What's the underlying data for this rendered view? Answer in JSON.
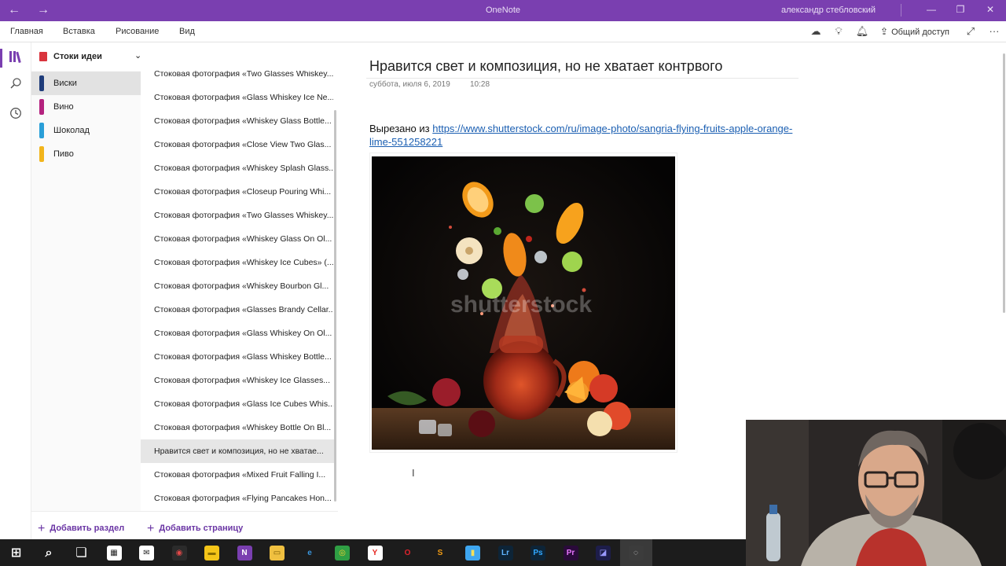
{
  "window": {
    "title": "OneNote",
    "user": "александр стебловский",
    "back_icon": "←",
    "forward_icon": "→",
    "minimize": "—",
    "restore": "❐",
    "close": "✕"
  },
  "menu": {
    "items": [
      "Главная",
      "Вставка",
      "Рисование",
      "Вид"
    ],
    "share_label": "Общий доступ",
    "more": "···"
  },
  "notebook": {
    "name": "Стоки идеи",
    "chevron": "⌄"
  },
  "sections": [
    {
      "label": "Виски",
      "color": "#1f3c7a"
    },
    {
      "label": "Вино",
      "color": "#b4237f"
    },
    {
      "label": "Шоколад",
      "color": "#2a9fd8"
    },
    {
      "label": "Пиво",
      "color": "#f2b51c"
    }
  ],
  "pages": [
    "Стоковая фотография «Two Glasses Whiskey...",
    "Стоковая фотография «Glass Whiskey Ice Ne...",
    "Стоковая фотография «Whiskey Glass Bottle...",
    "Стоковая фотография «Close View Two Glas...",
    "Стоковая фотография «Whiskey Splash Glass...",
    "Стоковая фотография «Closeup Pouring Whi...",
    "Стоковая фотография «Two Glasses Whiskey...",
    "Стоковая фотография «Whiskey Glass On Ol...",
    "Стоковая фотография «Whiskey Ice Cubes» (...",
    "Стоковая фотография «Whiskey Bourbon Gl...",
    "Стоковая фотография «Glasses Brandy Cellar...",
    "Стоковая фотография «Glass Whiskey On Ol...",
    "Стоковая фотография «Glass Whiskey Bottle...",
    "Стоковая фотография «Whiskey Ice Glasses...",
    "Стоковая фотография «Glass Ice Cubes Whis...",
    "Стоковая фотография «Whiskey Bottle On Bl...",
    "Нравится свет и композиция, но не хватае...",
    "Стоковая фотография «Mixed Fruit Falling I...",
    "Стоковая фотография «Flying Pancakes Hon..."
  ],
  "bottom": {
    "add_section": "Добавить раздел",
    "add_page": "Добавить страницу"
  },
  "note": {
    "title": "Нравится свет и композиция, но не хватает контрвого",
    "date": "суббота, июля 6, 2019",
    "time": "10:28",
    "clip_prefix": "Вырезано из",
    "clip_url": "https://www.shutterstock.com/ru/image-photo/sangria-flying-fruits-apple-orange-lime-551258221",
    "watermark": "shutterstock"
  },
  "taskbar": [
    {
      "name": "start-icon",
      "glyph": "⊞",
      "bg": "transparent",
      "fg": "#ffffff"
    },
    {
      "name": "search-icon",
      "glyph": "⌕",
      "bg": "transparent",
      "fg": "#ffffff"
    },
    {
      "name": "task-view-icon",
      "glyph": "❏",
      "bg": "transparent",
      "fg": "#ffffff"
    },
    {
      "name": "calendar-icon",
      "glyph": "▦",
      "bg": "#ffffff",
      "fg": "#222222"
    },
    {
      "name": "mail-icon",
      "glyph": "✉",
      "bg": "#ffffff",
      "fg": "#222222"
    },
    {
      "name": "webcam-app-icon",
      "glyph": "◉",
      "bg": "#2b2b2b",
      "fg": "#e04848"
    },
    {
      "name": "sticky-notes-icon",
      "glyph": "▬",
      "bg": "#f5c518",
      "fg": "#8a6d00"
    },
    {
      "name": "onenote-icon",
      "glyph": "N",
      "bg": "#7a3fb0",
      "fg": "#ffffff"
    },
    {
      "name": "file-explorer-icon",
      "glyph": "▭",
      "bg": "#f0c040",
      "fg": "#7a5a00"
    },
    {
      "name": "edge-icon",
      "glyph": "e",
      "bg": "transparent",
      "fg": "#3a96dd"
    },
    {
      "name": "chrome-icon",
      "glyph": "◎",
      "bg": "#2f9e44",
      "fg": "#f7d131"
    },
    {
      "name": "yandex-icon",
      "glyph": "Y",
      "bg": "#ffffff",
      "fg": "#e52620"
    },
    {
      "name": "opera-icon",
      "glyph": "O",
      "bg": "transparent",
      "fg": "#e0232d"
    },
    {
      "name": "app-s-icon",
      "glyph": "S",
      "bg": "transparent",
      "fg": "#f39c12"
    },
    {
      "name": "chart-app-icon",
      "glyph": "▮",
      "bg": "#3ea6f0",
      "fg": "#f5e05a"
    },
    {
      "name": "lightroom-icon",
      "glyph": "Lr",
      "bg": "#0d2437",
      "fg": "#5fb4ff"
    },
    {
      "name": "photoshop-icon",
      "glyph": "Ps",
      "bg": "#0d2437",
      "fg": "#31a8ff"
    },
    {
      "name": "premiere-icon",
      "glyph": "Pr",
      "bg": "#2a0a3a",
      "fg": "#ea77ff"
    },
    {
      "name": "media-encoder-icon",
      "glyph": "◪",
      "bg": "#1d1d4a",
      "fg": "#9999ff"
    },
    {
      "name": "obs-icon",
      "glyph": "◌",
      "bg": "#3c3c3c",
      "fg": "#dddddd"
    }
  ]
}
